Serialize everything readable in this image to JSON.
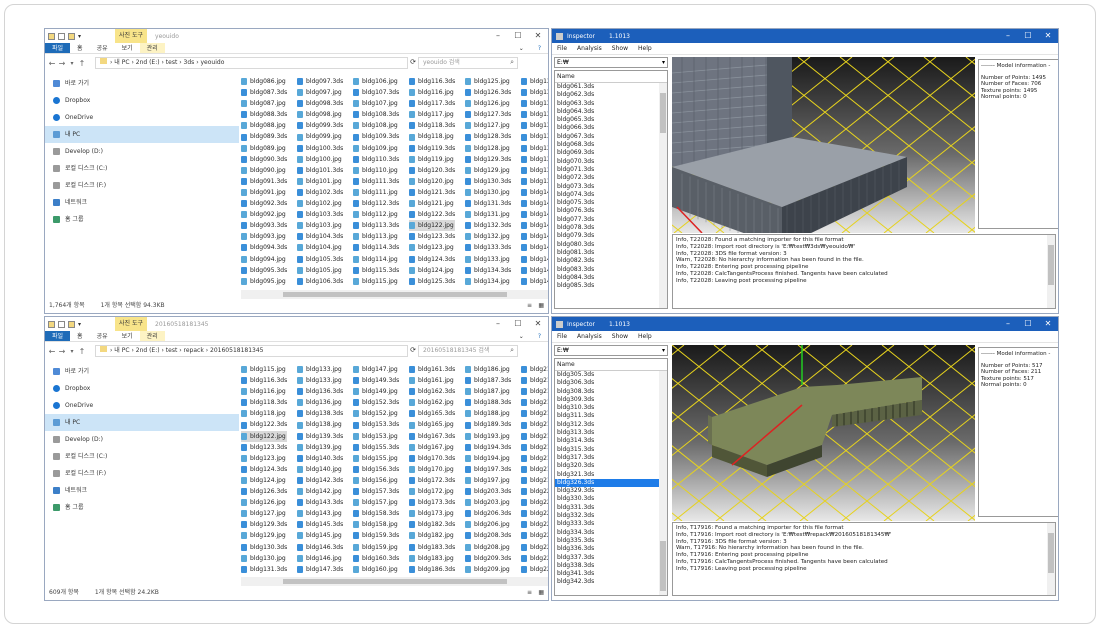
{
  "explorer_top": {
    "context_tab": "사진 도구",
    "title": "yeouido",
    "ribbon": {
      "file": "파일",
      "home": "홈",
      "share": "공유",
      "view": "보기",
      "manage": "관리"
    },
    "path": "› 내 PC › 2nd (E:) › test › 3ds › yeouido",
    "search_placeholder": "yeouido 검색",
    "nav": [
      "바로 가기",
      "Dropbox",
      "OneDrive",
      "내 PC",
      "Develop (D:)",
      "로컬 디스크 (C:)",
      "로컬 디스크 (F:)",
      "네트워크",
      "홈 그룹"
    ],
    "columns": [
      [
        "bldg086.jpg",
        "bldg087.3ds",
        "bldg087.jpg",
        "bldg088.3ds",
        "bldg088.jpg",
        "bldg089.3ds",
        "bldg089.jpg",
        "bldg090.3ds",
        "bldg090.jpg",
        "bldg091.3ds",
        "bldg091.jpg",
        "bldg092.3ds",
        "bldg092.jpg",
        "bldg093.3ds",
        "bldg093.jpg",
        "bldg094.3ds",
        "bldg094.jpg",
        "bldg095.3ds",
        "bldg095.jpg"
      ],
      [
        "bldg097.3ds",
        "bldg097.jpg",
        "bldg098.3ds",
        "bldg098.jpg",
        "bldg099.3ds",
        "bldg099.jpg",
        "bldg100.3ds",
        "bldg100.jpg",
        "bldg101.3ds",
        "bldg101.jpg",
        "bldg102.3ds",
        "bldg102.jpg",
        "bldg103.3ds",
        "bldg103.jpg",
        "bldg104.3ds",
        "bldg104.jpg",
        "bldg105.3ds",
        "bldg105.jpg",
        "bldg106.3ds"
      ],
      [
        "bldg106.jpg",
        "bldg107.3ds",
        "bldg107.jpg",
        "bldg108.3ds",
        "bldg108.jpg",
        "bldg109.3ds",
        "bldg109.jpg",
        "bldg110.3ds",
        "bldg110.jpg",
        "bldg111.3ds",
        "bldg111.jpg",
        "bldg112.3ds",
        "bldg112.jpg",
        "bldg113.3ds",
        "bldg113.jpg",
        "bldg114.3ds",
        "bldg114.jpg",
        "bldg115.3ds",
        "bldg115.jpg"
      ],
      [
        "bldg116.3ds",
        "bldg116.jpg",
        "bldg117.3ds",
        "bldg117.jpg",
        "bldg118.3ds",
        "bldg118.jpg",
        "bldg119.3ds",
        "bldg119.jpg",
        "bldg120.3ds",
        "bldg120.jpg",
        "bldg121.3ds",
        "bldg121.jpg",
        "bldg122.3ds",
        "bldg122.jpg",
        "bldg123.3ds",
        "bldg123.jpg",
        "bldg124.3ds",
        "bldg124.jpg",
        "bldg125.3ds"
      ],
      [
        "bldg125.jpg",
        "bldg126.3ds",
        "bldg126.jpg",
        "bldg127.3ds",
        "bldg127.jpg",
        "bldg128.3ds",
        "bldg128.jpg",
        "bldg129.3ds",
        "bldg129.jpg",
        "bldg130.3ds",
        "bldg130.jpg",
        "bldg131.3ds",
        "bldg131.jpg",
        "bldg132.3ds",
        "bldg132.jpg",
        "bldg133.3ds",
        "bldg133.jpg",
        "bldg134.3ds",
        "bldg134.jpg"
      ],
      [
        "bldg135",
        "bldg135",
        "bldg136",
        "bldg136",
        "bldg137",
        "bldg137",
        "bldg138",
        "bldg138",
        "bldg139",
        "bldg139",
        "bldg140",
        "bldg140",
        "bldg141",
        "bldg141",
        "bldg142",
        "bldg142",
        "bldg143",
        "bldg143",
        "bldg144"
      ]
    ],
    "selected": "bldg122.jpg",
    "status_count": "1,764개 항목",
    "status_sel": "1개 항목 선택함 94.3KB"
  },
  "explorer_bottom": {
    "context_tab": "사진 도구",
    "title": "20160518181345",
    "ribbon": {
      "file": "파일",
      "home": "홈",
      "share": "공유",
      "view": "보기",
      "manage": "관리"
    },
    "path": "› 내 PC › 2nd (E:) › test › repack › 20160518181345",
    "search_placeholder": "20160518181345 검색",
    "nav": [
      "바로 가기",
      "Dropbox",
      "OneDrive",
      "내 PC",
      "Develop (D:)",
      "로컬 디스크 (C:)",
      "로컬 디스크 (F:)",
      "네트워크",
      "홈 그룹"
    ],
    "columns": [
      [
        "bldg115.jpg",
        "bldg116.3ds",
        "bldg116.jpg",
        "bldg118.3ds",
        "bldg118.jpg",
        "bldg122.3ds",
        "bldg122.jpg",
        "bldg123.3ds",
        "bldg123.jpg",
        "bldg124.3ds",
        "bldg124.jpg",
        "bldg126.3ds",
        "bldg126.jpg",
        "bldg127.jpg",
        "bldg129.3ds",
        "bldg129.jpg",
        "bldg130.3ds",
        "bldg130.jpg",
        "bldg131.3ds"
      ],
      [
        "bldg133.jpg",
        "bldg133.jpg",
        "bldg136.3ds",
        "bldg136.jpg",
        "bldg138.3ds",
        "bldg138.jpg",
        "bldg139.3ds",
        "bldg139.jpg",
        "bldg140.3ds",
        "bldg140.jpg",
        "bldg142.3ds",
        "bldg142.jpg",
        "bldg143.3ds",
        "bldg143.jpg",
        "bldg145.3ds",
        "bldg145.jpg",
        "bldg146.3ds",
        "bldg146.jpg",
        "bldg147.3ds"
      ],
      [
        "bldg147.jpg",
        "bldg149.3ds",
        "bldg149.jpg",
        "bldg152.3ds",
        "bldg152.jpg",
        "bldg153.3ds",
        "bldg153.jpg",
        "bldg155.3ds",
        "bldg155.jpg",
        "bldg156.3ds",
        "bldg156.jpg",
        "bldg157.3ds",
        "bldg157.jpg",
        "bldg158.3ds",
        "bldg158.jpg",
        "bldg159.3ds",
        "bldg159.jpg",
        "bldg160.3ds",
        "bldg160.jpg"
      ],
      [
        "bldg161.3ds",
        "bldg161.jpg",
        "bldg162.3ds",
        "bldg162.jpg",
        "bldg165.3ds",
        "bldg165.jpg",
        "bldg167.3ds",
        "bldg167.jpg",
        "bldg170.3ds",
        "bldg170.jpg",
        "bldg172.3ds",
        "bldg172.jpg",
        "bldg173.3ds",
        "bldg173.jpg",
        "bldg182.3ds",
        "bldg182.jpg",
        "bldg183.3ds",
        "bldg183.jpg",
        "bldg186.3ds"
      ],
      [
        "bldg186.jpg",
        "bldg187.3ds",
        "bldg187.jpg",
        "bldg188.3ds",
        "bldg188.jpg",
        "bldg189.3ds",
        "bldg193.jpg",
        "bldg194.3ds",
        "bldg194.jpg",
        "bldg197.3ds",
        "bldg197.jpg",
        "bldg203.3ds",
        "bldg203.jpg",
        "bldg206.3ds",
        "bldg206.jpg",
        "bldg208.3ds",
        "bldg208.jpg",
        "bldg209.3ds",
        "bldg209.jpg"
      ],
      [
        "bldg21",
        "bldg21",
        "bldg21",
        "bldg21",
        "bldg21",
        "bldg21",
        "bldg21",
        "bldg21",
        "bldg21",
        "bldg21",
        "bldg21",
        "bldg22",
        "bldg22",
        "bldg22",
        "bldg22",
        "bldg22",
        "bldg22",
        "bldg22",
        "bldg22"
      ]
    ],
    "selected": "bldg122.jpg",
    "status_count": "609개 항목",
    "status_sel": "1개 항목 선택함 24.2KB"
  },
  "inspector_top": {
    "title": "Inspector",
    "version": "1.1013",
    "menu": [
      "File",
      "Analysis",
      "Show",
      "Help"
    ],
    "drive": "E:₩",
    "list_header": "Name",
    "items": [
      "bldg061.3ds",
      "bldg062.3ds",
      "bldg063.3ds",
      "bldg064.3ds",
      "bldg065.3ds",
      "bldg066.3ds",
      "bldg067.3ds",
      "bldg068.3ds",
      "bldg069.3ds",
      "bldg070.3ds",
      "bldg071.3ds",
      "bldg072.3ds",
      "bldg073.3ds",
      "bldg074.3ds",
      "bldg075.3ds",
      "bldg076.3ds",
      "bldg077.3ds",
      "bldg078.3ds",
      "bldg079.3ds",
      "bldg080.3ds",
      "bldg081.3ds",
      "bldg082.3ds",
      "bldg083.3ds",
      "bldg084.3ds",
      "bldg085.3ds"
    ],
    "info_title": "------- Model information -",
    "info": [
      "Number of Points: 1495",
      "Number of Faces: 706",
      "Texture points: 1495",
      "Normal points: 0"
    ],
    "log": [
      "Info,  T22028: Found a matching importer for this file format",
      "Info,  T22028: Import root directory is 'E:₩test₩3ds₩yeouido₩'",
      "Info,  T22028: 3DS file format version: 3",
      "Warn,  T22028: No hierarchy information has been found in the file.",
      "Info,  T22028: Entering post processing pipeline",
      "Info,  T22028: CalcTangentsProcess finished. Tangents have been calculated",
      "Info,  T22028: Leaving post processing pipeline"
    ]
  },
  "inspector_bottom": {
    "title": "Inspector",
    "version": "1.1013",
    "menu": [
      "File",
      "Analysis",
      "Show",
      "Help"
    ],
    "drive": "E:₩",
    "list_header": "Name",
    "items": [
      "bldg305.3ds",
      "bldg306.3ds",
      "bldg308.3ds",
      "bldg309.3ds",
      "bldg310.3ds",
      "bldg311.3ds",
      "bldg312.3ds",
      "bldg313.3ds",
      "bldg314.3ds",
      "bldg315.3ds",
      "bldg317.3ds",
      "bldg320.3ds",
      "bldg321.3ds",
      "bldg326.3ds",
      "bldg329.3ds",
      "bldg330.3ds",
      "bldg331.3ds",
      "bldg332.3ds",
      "bldg333.3ds",
      "bldg334.3ds",
      "bldg335.3ds",
      "bldg336.3ds",
      "bldg337.3ds",
      "bldg338.3ds",
      "bldg341.3ds",
      "bldg342.3ds"
    ],
    "selected_index": 13,
    "info_title": "------- Model information -",
    "info": [
      "Number of Points: 517",
      "Number of Faces: 211",
      "Texture points: 517",
      "Normal points: 0"
    ],
    "log": [
      "Info,  T17916: Found a matching importer for this file format",
      "Info,  T17916: Import root directory is 'E:₩test₩repack₩20160518181345₩'",
      "Info,  T17916: 3DS file format version: 3",
      "Warn,  T17916: No hierarchy information has been found in the file.",
      "Info,  T17916: Entering post processing pipeline",
      "Info,  T17916: CalcTangentsProcess finished. Tangents have been calculated",
      "Info,  T17916: Leaving post processing pipeline"
    ]
  }
}
